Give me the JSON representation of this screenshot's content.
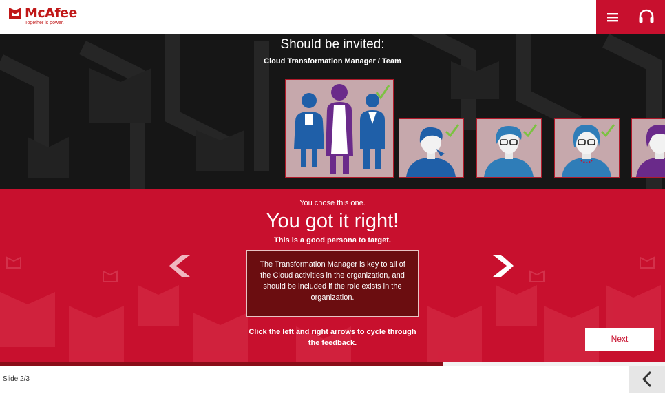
{
  "header": {
    "logo_name": "McAfee",
    "logo_tagline": "Together is power.",
    "menu_icon": "hamburger-menu-icon",
    "audio_icon": "headphones-icon"
  },
  "banner": {
    "title": "Should be invited:",
    "subtitle": "Cloud Transformation Manager / Team",
    "personas": [
      {
        "name": "team-group",
        "checked": true,
        "selected": true
      },
      {
        "name": "woman-short-hair",
        "checked": true
      },
      {
        "name": "woman-glasses",
        "checked": true
      },
      {
        "name": "woman-older-glasses",
        "checked": true
      },
      {
        "name": "woman-purple",
        "checked": false
      }
    ]
  },
  "feedback": {
    "chose_text": "You chose this one.",
    "result_title": "You got it right!",
    "result_subtitle": "This is a good persona to target.",
    "body": "The Transformation Manager is key to all of the Cloud activities in the organization, and should be included if the role exists in the organization.",
    "instruction": "Click the left and right arrows to cycle through the feedback.",
    "next_label": "Next"
  },
  "progress": {
    "fraction": 0.667
  },
  "footer": {
    "slide_label": "Slide 2/3",
    "back_icon": "chevron-left-icon"
  },
  "colors": {
    "brand_red": "#c8102e",
    "dark_bg": "#141414",
    "feedback_box": "#6b0d10",
    "progress": "#8a0d18",
    "check_green": "#7cc242",
    "persona_blue": "#1f5fa8",
    "persona_purple": "#6a2a8a"
  }
}
